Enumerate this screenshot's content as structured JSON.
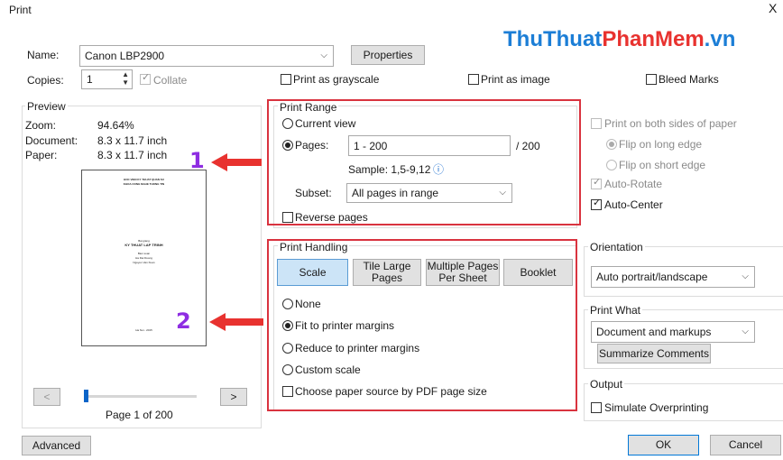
{
  "window": {
    "title": "Print",
    "close_glyph": "X"
  },
  "watermark": {
    "part1": "ThuThuat",
    "part2": "PhanMem",
    "part3": ".vn",
    "colors": {
      "part1": "#1c7ed6",
      "part2": "#e8322f",
      "part3": "#1c7ed6"
    }
  },
  "printer": {
    "name_label": "Name:",
    "name_value": "Canon LBP2900",
    "properties_label": "Properties",
    "copies_label": "Copies:",
    "copies_value": "1",
    "collate_label": "Collate",
    "grayscale_label": "Print as grayscale",
    "image_label": "Print as image",
    "bleed_label": "Bleed Marks"
  },
  "preview": {
    "section_label": "Preview",
    "zoom_label": "Zoom:",
    "zoom_value": "94.64%",
    "document_label": "Document:",
    "document_value": "8.3 x 11.7 inch",
    "paper_label": "Paper:",
    "paper_value": "8.3 x 11.7 inch",
    "prev_glyph": "<",
    "next_glyph": ">",
    "page_status": "Page 1 of 200",
    "slider_position_fraction": 0.0,
    "page_lines": {
      "header1": "HOC VIEN KY THUAT QUAN SU",
      "header2": "KHOA CONG NGHE THONG TIN",
      "small": "Bai giang",
      "title": "KY THUAT LAP TRINH",
      "sub1": "Bien soan",
      "sub2": "Ha Dai Duong",
      "sub3": "Nguyen Van Xuan",
      "footer": "Ha Noi - 2015"
    }
  },
  "print_range": {
    "section_label": "Print Range",
    "current_view_label": "Current view",
    "pages_label": "Pages:",
    "pages_value": "1 - 200",
    "pages_total": "/ 200",
    "sample_text": "Sample: 1,5-9,12",
    "info_glyph": "ⓘ",
    "subset_label": "Subset:",
    "subset_value": "All pages in range",
    "reverse_label": "Reverse pages"
  },
  "print_handling": {
    "section_label": "Print Handling",
    "tabs": [
      "Scale",
      "Tile Large\nPages",
      "Multiple Pages\nPer Sheet",
      "Booklet"
    ],
    "none_label": "None",
    "fit_label": "Fit to printer margins",
    "reduce_label": "Reduce to printer margins",
    "custom_label": "Custom scale",
    "paper_source_label": "Choose paper source by PDF page size"
  },
  "duplex": {
    "both_sides_label": "Print on both sides of paper",
    "long_edge_label": "Flip on long edge",
    "short_edge_label": "Flip on short edge",
    "auto_rotate_label": "Auto-Rotate",
    "auto_center_label": "Auto-Center"
  },
  "orientation": {
    "section_label": "Orientation",
    "value": "Auto portrait/landscape"
  },
  "print_what": {
    "section_label": "Print What",
    "value": "Document and markups",
    "summarize_label": "Summarize Comments"
  },
  "output": {
    "section_label": "Output",
    "simulate_label": "Simulate Overprinting"
  },
  "footer": {
    "advanced_label": "Advanced",
    "ok_label": "OK",
    "cancel_label": "Cancel"
  },
  "annotations": {
    "num1": "1",
    "num2": "2",
    "arrow_color": "#e8322f",
    "box_color": "#d9333f",
    "num_color": "#8e2de2"
  }
}
